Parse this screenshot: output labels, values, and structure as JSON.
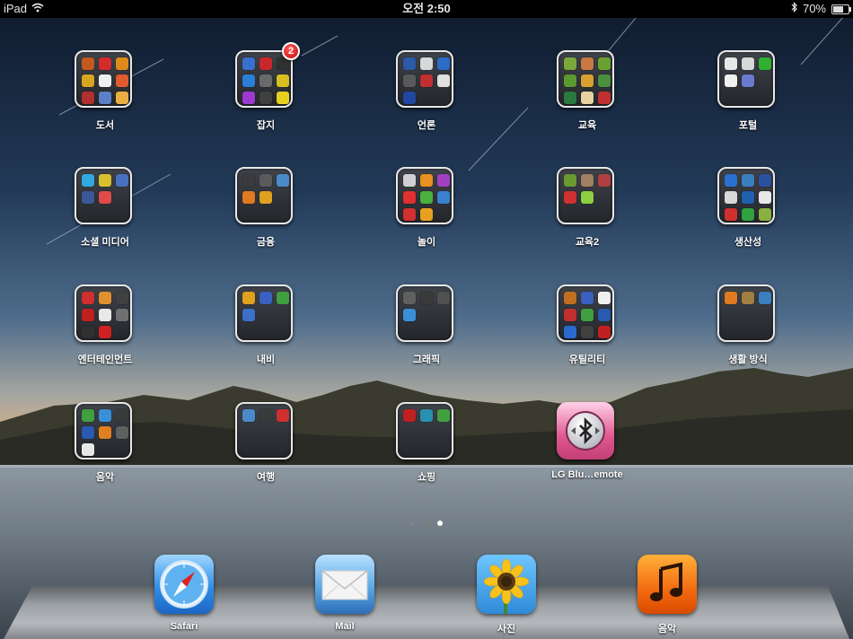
{
  "status_bar": {
    "device": "iPad",
    "time": "오전 2:50",
    "battery": "70%",
    "battery_level": 0.7
  },
  "home": {
    "folders": [
      {
        "label": "도서",
        "icons": [
          "#c25a1f",
          "#d42b2b",
          "#e08a1a",
          "#d9a521",
          "#f0f0f0",
          "#e05a30",
          "#b23030",
          "#5a80c8",
          "#e8b040"
        ]
      },
      {
        "label": "잡지",
        "badge": "2",
        "icons": [
          "#3a6fd0",
          "#c8282a",
          "#303030",
          "#2c7fd8",
          "#6a6a6a",
          "#d8c020",
          "#9b3ad0",
          "#404040",
          "#e8d020"
        ]
      },
      {
        "label": "언론",
        "icons": [
          "#2a5aa8",
          "#d8d8d8",
          "#2c6cc8",
          "#5a5a5a",
          "#c03030",
          "#e0e0e0",
          "#2048a0"
        ]
      },
      {
        "label": "교육",
        "icons": [
          "#7aa83a",
          "#c87840",
          "#6aa030",
          "#5a9a30",
          "#d8a030",
          "#4a9040",
          "#2a7a40",
          "#e8d0a0",
          "#c03030"
        ]
      },
      {
        "label": "포털",
        "icons": [
          "#e8e8e8",
          "#d8d8d8",
          "#30b030",
          "#f0f0f0",
          "#6a7ad0"
        ]
      },
      {
        "label": "소셜 미디어",
        "icons": [
          "#30a8e0",
          "#d8c030",
          "#4a70c0",
          "#3b5998",
          "#e04a4a"
        ]
      },
      {
        "label": "금융",
        "icons": [
          "#3a3a3a",
          "#5a5a5a",
          "#4a8ac8",
          "#e07a20",
          "#e0a020"
        ]
      },
      {
        "label": "놀이",
        "icons": [
          "#d0d0d0",
          "#e89020",
          "#a040c0",
          "#e03030",
          "#4ab040",
          "#3a80d0",
          "#d03030",
          "#e8a020"
        ]
      },
      {
        "label": "교육2",
        "icons": [
          "#6a9a30",
          "#a08060",
          "#b04040",
          "#d03030",
          "#8ad040"
        ]
      },
      {
        "label": "생산성",
        "icons": [
          "#2a70d0",
          "#3a80c0",
          "#2a50a0",
          "#d8d8d8",
          "#2060b0",
          "#e8e8e8",
          "#d03030",
          "#30a040",
          "#8ab040"
        ]
      },
      {
        "label": "엔터테인먼트",
        "icons": [
          "#d03030",
          "#e09030",
          "#404040",
          "#c02020",
          "#e8e8e8",
          "#707070",
          "#303030",
          "#d02020"
        ]
      },
      {
        "label": "내비",
        "icons": [
          "#e0a020",
          "#3a60c0",
          "#40a040",
          "#3a70c8"
        ]
      },
      {
        "label": "그래픽",
        "icons": [
          "#606060",
          "#3a3a3a",
          "#505050",
          "#3a90d8"
        ]
      },
      {
        "label": "유틸리티",
        "icons": [
          "#c07020",
          "#3a60c0",
          "#f0f0f0",
          "#c03030",
          "#40a040",
          "#2a5ab0",
          "#2a6ad0",
          "#404040",
          "#c02020"
        ]
      },
      {
        "label": "생활 방식",
        "icons": [
          "#e07a20",
          "#a08040",
          "#3a80c0"
        ]
      },
      {
        "label": "음악",
        "icons": [
          "#40a040",
          "#3a90d8",
          "#3a3a3a",
          "#2a5ab0",
          "#e08020",
          "#606060",
          "#e8e8e8"
        ]
      },
      {
        "label": "여행",
        "icons": [
          "#4a8ac8",
          "#3a3a3a",
          "#d03030"
        ]
      },
      {
        "label": "쇼핑",
        "icons": [
          "#c02020",
          "#2a90b0",
          "#40a040"
        ]
      }
    ],
    "app": {
      "label": "LG Blu…emote",
      "icon": "bluetooth-remote-icon"
    }
  },
  "page_indicator": {
    "pages": 3,
    "current": 3
  },
  "dock": [
    {
      "label": "Safari",
      "icon": "compass-icon"
    },
    {
      "label": "Mail",
      "icon": "envelope-icon"
    },
    {
      "label": "사진",
      "icon": "sunflower-icon"
    },
    {
      "label": "음악",
      "icon": "music-note-icon"
    }
  ]
}
